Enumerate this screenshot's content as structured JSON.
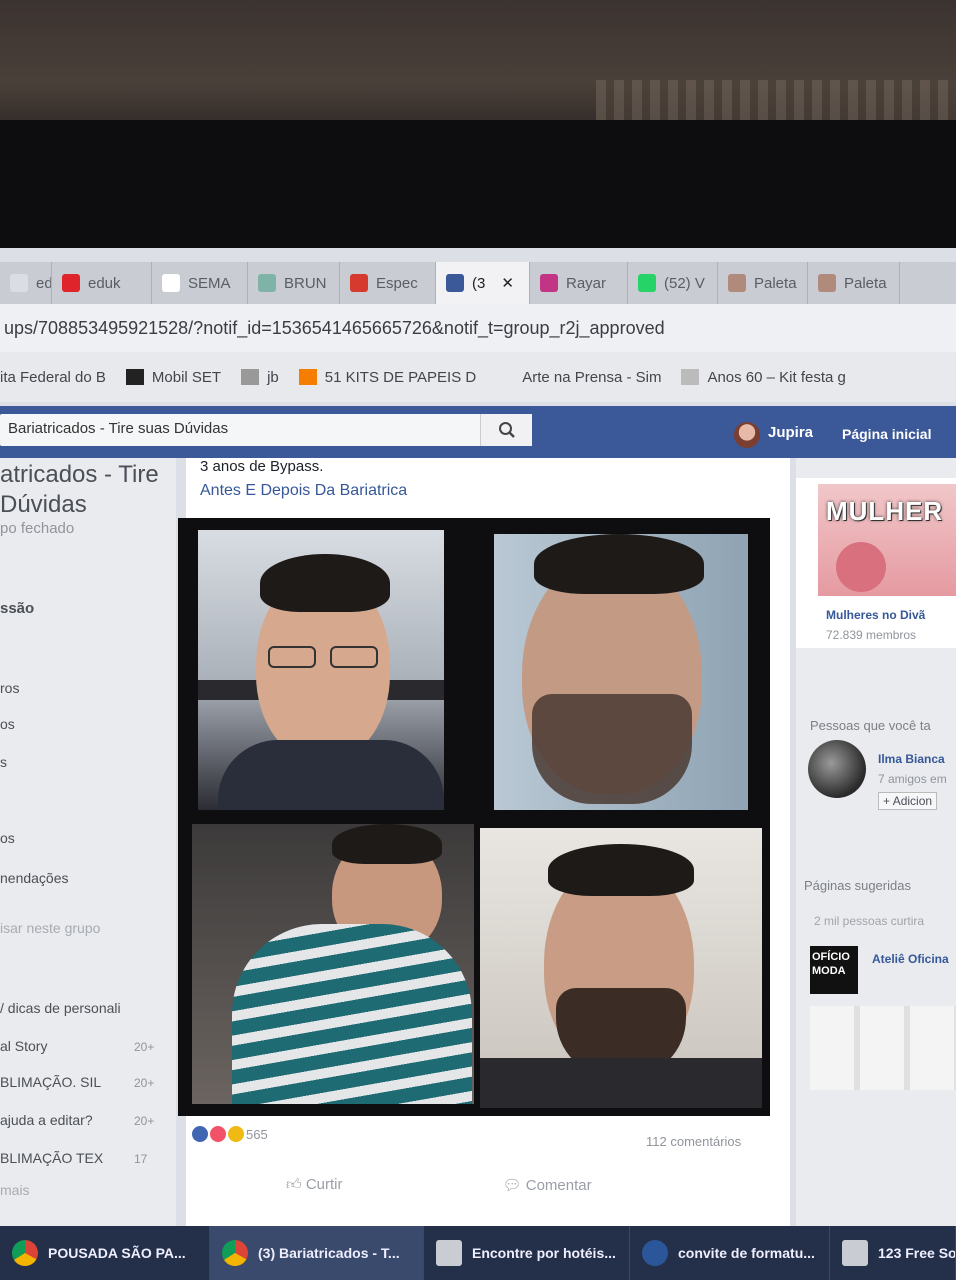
{
  "tabs": [
    {
      "label": "eduk",
      "icon": "eduk-icon",
      "color": "#dadde3"
    },
    {
      "label": "eduk",
      "icon": "eduk-k-icon",
      "color": "#e0242b"
    },
    {
      "label": "SEMA",
      "icon": "document-icon",
      "color": "#ffffff"
    },
    {
      "label": "BRUN",
      "icon": "leaf-icon",
      "color": "#7fb3a7"
    },
    {
      "label": "Espec",
      "icon": "opera-o-icon",
      "color": "#d63a2f"
    },
    {
      "label": "(3",
      "icon": "facebook-icon",
      "color": "#3b5998",
      "active": true,
      "close": "✕"
    },
    {
      "label": "Rayar",
      "icon": "instagram-icon",
      "color": "#c13584"
    },
    {
      "label": "(52) V",
      "icon": "whatsapp-icon",
      "color": "#25d366"
    },
    {
      "label": "Paleta",
      "icon": "palette-icon",
      "color": "#b08a7a"
    },
    {
      "label": "Paleta",
      "icon": "palette-icon",
      "color": "#b08a7a"
    }
  ],
  "url": "ups/708853495921528/?notif_id=1536541465665726&notif_t=group_r2j_approved",
  "bookmarks": [
    {
      "label": "ita Federal do B",
      "icon": "gov-icon"
    },
    {
      "label": "Mobil SET",
      "icon": "clapper-icon"
    },
    {
      "label": "jb",
      "icon": "jb-icon"
    },
    {
      "label": "51 KITS DE PAPEIS D",
      "icon": "blogger-icon"
    },
    {
      "label": "Arte na Prensa - Sim",
      "icon": "pin-icon"
    },
    {
      "label": "Anos 60 – Kit festa g",
      "icon": "image-icon"
    }
  ],
  "fb": {
    "search_value": "Bariatricados - Tire suas Dúvidas",
    "user": "Jupira",
    "home": "Página inicial"
  },
  "left": {
    "group_title": "atricados - Tire\nDúvidas",
    "group_type": "po fechado",
    "items": [
      {
        "label": "ssão"
      },
      {
        "label": "ros"
      },
      {
        "label": "os"
      },
      {
        "label": "s"
      },
      {
        "label": "os"
      },
      {
        "label": "nendações"
      },
      {
        "label": "isar neste grupo"
      },
      {
        "label": "/ dicas de personali"
      },
      {
        "label": "al Story",
        "count": "20+"
      },
      {
        "label": "BLIMAÇÃO. SIL",
        "count": "20+"
      },
      {
        "label": "ajuda a editar?",
        "count": "20+"
      },
      {
        "label": "BLIMAÇÃO TEX",
        "count": "17"
      },
      {
        "label": "mais"
      }
    ]
  },
  "post": {
    "line1": "3 anos de Bypass.",
    "line2": "Antes E Depois Da Bariatrica",
    "reactions_count": "565",
    "comments_count": "112 comentários",
    "like": "Curtir",
    "comment": "Comentar"
  },
  "right": {
    "ad_banner": "MULHER",
    "ad_name": "Mulheres no Divã",
    "ad_members": "72.839 membros",
    "people_heading": "Pessoas que você ta",
    "person_name": "Ilma Bianca",
    "person_mutual": "7 amigos em",
    "add_button": "Adicion",
    "pages_heading": "Páginas sugeridas",
    "pages_likes": "2 mil pessoas curtira",
    "page_name": "Ateliê Oficina",
    "page_logo": "OFÍCIO\nMODA"
  },
  "taskbar": [
    {
      "label": "POUSADA SÃO PA...",
      "icon": "chrome-icon"
    },
    {
      "label": "(3) Bariatricados - T...",
      "icon": "chrome-icon",
      "active": true
    },
    {
      "label": "Encontre por hotéis...",
      "icon": "document-icon"
    },
    {
      "label": "convite de formatu...",
      "icon": "word-icon"
    },
    {
      "label": "123 Free So",
      "icon": "app-icon"
    }
  ]
}
